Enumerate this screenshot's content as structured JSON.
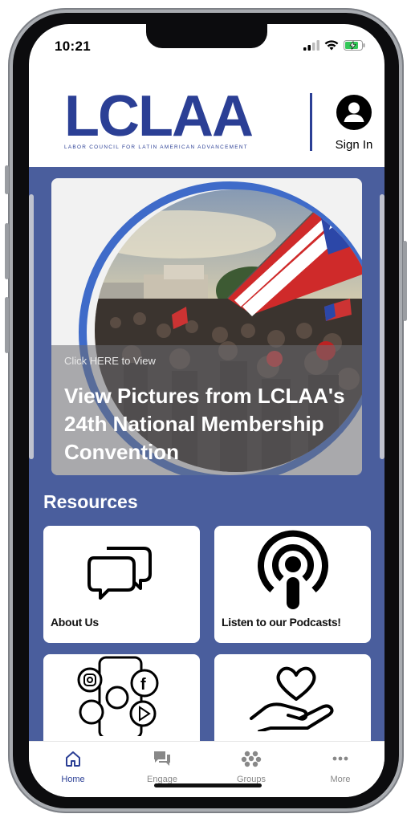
{
  "status_bar": {
    "time": "10:21"
  },
  "header": {
    "logo_text": "LCLAA",
    "logo_subtitle": "LABOR COUNCIL FOR LATIN AMERICAN ADVANCEMENT",
    "sign_in_label": "Sign In"
  },
  "hero": {
    "click_text": "Click HERE to View",
    "title": "View Pictures from LCLAA's 24th National Membership Convention"
  },
  "resources": {
    "title": "Resources",
    "tiles": [
      {
        "label": "About Us",
        "icon": "chat-bubbles-icon"
      },
      {
        "label": "Listen to our Podcasts!",
        "icon": "podcast-icon"
      },
      {
        "label": "",
        "icon": "social-media-icon"
      },
      {
        "label": "",
        "icon": "heart-hand-icon"
      }
    ]
  },
  "tabbar": {
    "tabs": [
      {
        "label": "Home",
        "icon": "home-icon",
        "active": true
      },
      {
        "label": "Engage",
        "icon": "chat-icon"
      },
      {
        "label": "Groups",
        "icon": "groups-icon"
      },
      {
        "label": "More",
        "icon": "more-icon"
      }
    ]
  },
  "colors": {
    "brand": "#2b3f95",
    "content_bg": "#4a5e9d",
    "tab_active": "#2b3f95",
    "tab_inactive": "#888888"
  }
}
